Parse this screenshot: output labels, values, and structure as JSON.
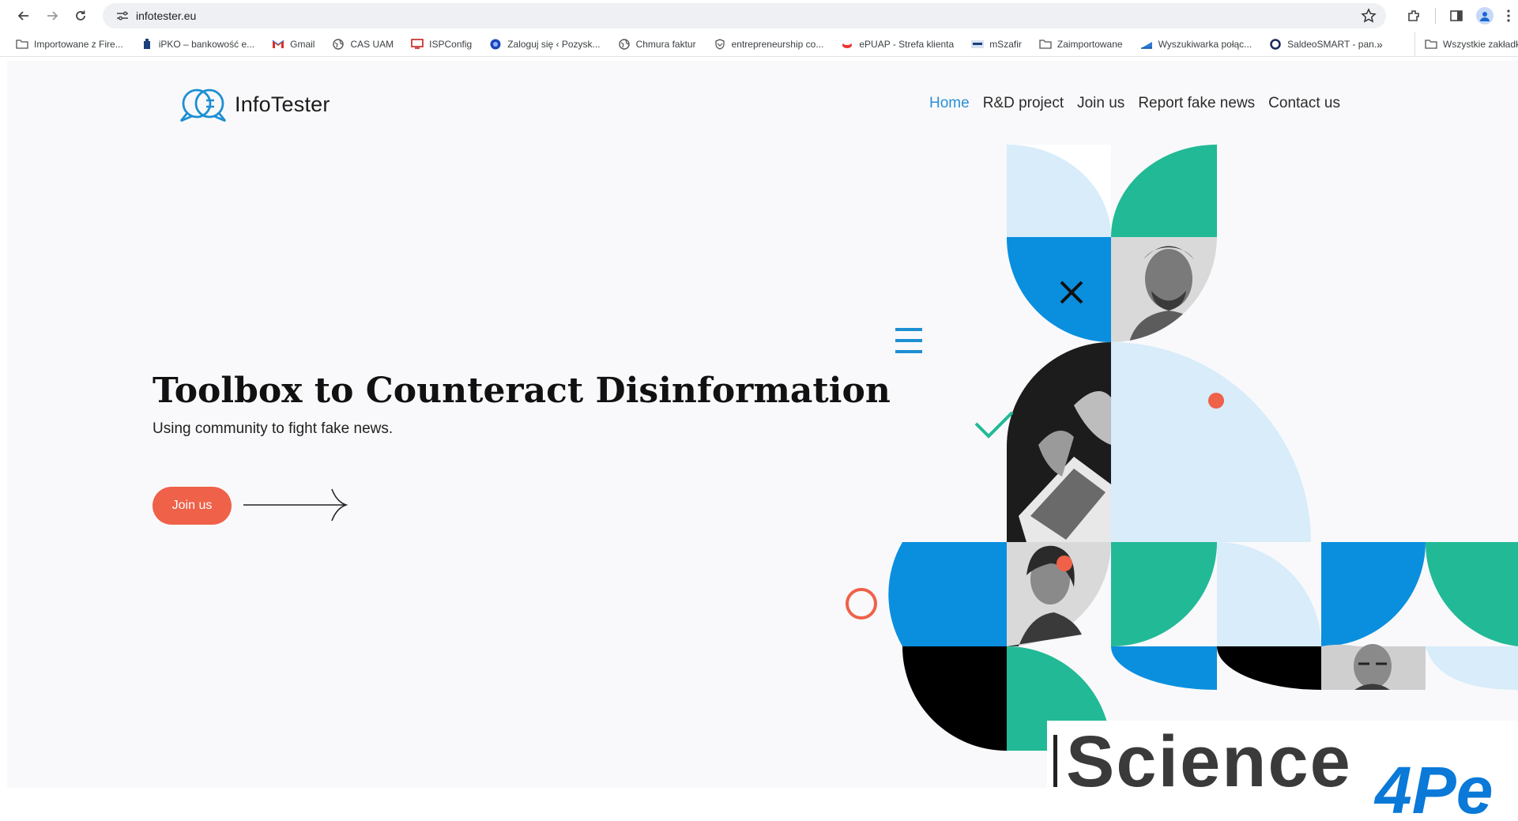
{
  "browser": {
    "url": "infotester.eu",
    "bookmarks": [
      {
        "label": "Importowane z Fire...",
        "icon": "folder-icon"
      },
      {
        "label": "iPKO – bankowość e...",
        "icon": "bank-icon"
      },
      {
        "label": "Gmail",
        "icon": "gmail-icon"
      },
      {
        "label": "CAS UAM",
        "icon": "globe-icon"
      },
      {
        "label": "ISPConfig",
        "icon": "monitor-icon"
      },
      {
        "label": "Zaloguj się ‹ Pozysk...",
        "icon": "site-icon"
      },
      {
        "label": "Chmura faktur",
        "icon": "globe-icon"
      },
      {
        "label": "entrepreneurship co...",
        "icon": "shield-icon"
      },
      {
        "label": "ePUAP - Strefa klienta",
        "icon": "epuap-icon"
      },
      {
        "label": "mSzafir",
        "icon": "card-icon"
      },
      {
        "label": "Zaimportowane",
        "icon": "folder-icon"
      },
      {
        "label": "Wyszukiwarka połąc...",
        "icon": "train-icon"
      },
      {
        "label": "SaldeoSMART - pan...",
        "icon": "circle-icon"
      }
    ],
    "more_bookmarks": "»",
    "all_bookmarks": "Wszystkie zakładki"
  },
  "site": {
    "logo_text": "InfoTester",
    "nav": [
      {
        "label": "Home",
        "active": true
      },
      {
        "label": "R&D project",
        "active": false
      },
      {
        "label": "Join us",
        "active": false
      },
      {
        "label": "Report fake news",
        "active": false
      },
      {
        "label": "Contact us",
        "active": false
      }
    ],
    "hero": {
      "title_plain": "Toolbox to ",
      "title_strong": "Counteract Disinformation",
      "subtitle": "Using community to fight fake news.",
      "cta_label": "Join us"
    },
    "overlay_banner": {
      "text": "Science",
      "suffix": "4Pe"
    }
  },
  "colors": {
    "accent_blue": "#2a8fd6",
    "cta_red": "#ef6149",
    "art_blue": "#0a8fdf",
    "art_green": "#22b996",
    "art_light": "#d8ecfa"
  }
}
